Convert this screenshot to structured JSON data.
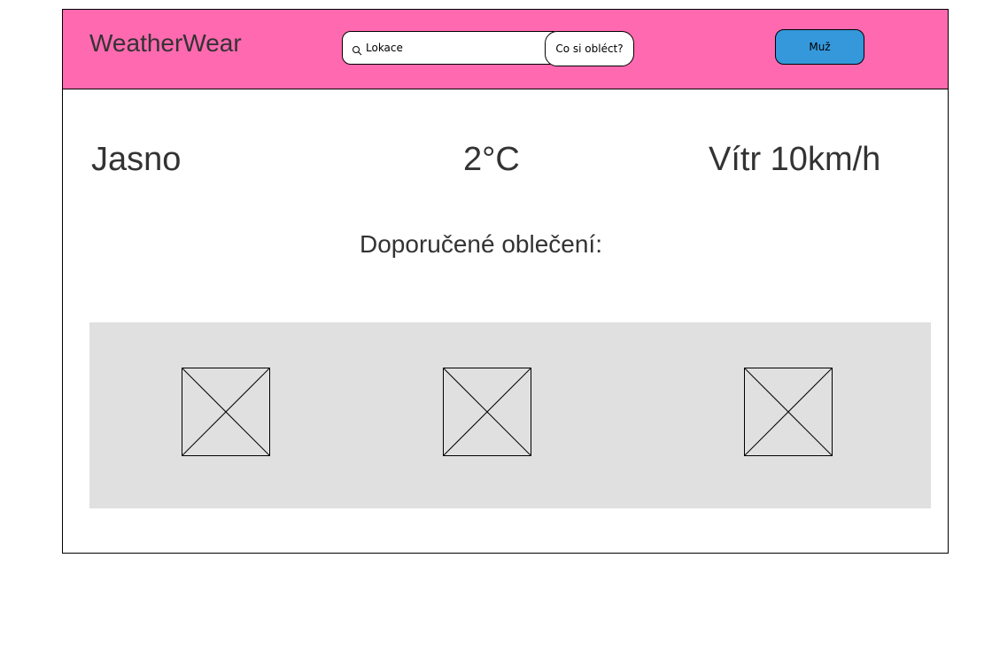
{
  "header": {
    "logo": "WeatherWear",
    "search": {
      "placeholder": "Lokace",
      "icon": "search-icon"
    },
    "search_button_label": "Co si obléct?",
    "gender_button_label": "Muž",
    "background_color": "#ff69b0",
    "gender_button_color": "#3498db"
  },
  "weather": {
    "condition": "Jasno",
    "temperature": "2°C",
    "wind": "Vítr 10km/h"
  },
  "recommendation": {
    "title": "Doporučené oblečení:",
    "items": [
      {
        "icon": "image-placeholder-icon"
      },
      {
        "icon": "image-placeholder-icon"
      },
      {
        "icon": "image-placeholder-icon"
      }
    ],
    "panel_color": "#e0e0e0"
  }
}
